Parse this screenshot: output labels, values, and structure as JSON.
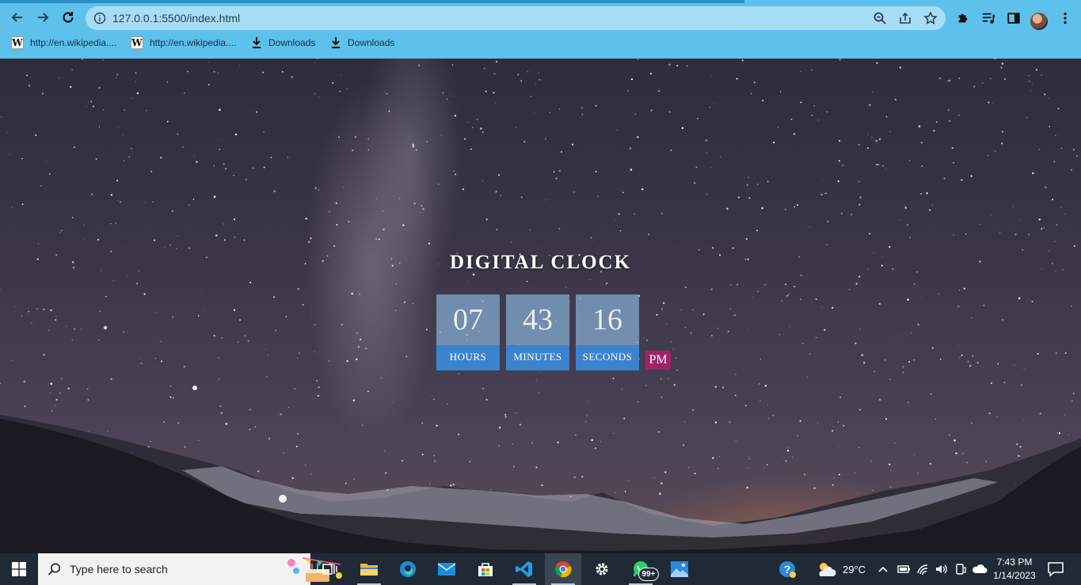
{
  "browser": {
    "url": "127.0.0.1:5500/index.html",
    "bookmarks": [
      {
        "label": "http://en.wikipedia....",
        "icon": "wikipedia-icon"
      },
      {
        "label": "http://en.wikipedia....",
        "icon": "wikipedia-icon"
      },
      {
        "label": "Downloads",
        "icon": "download-icon"
      },
      {
        "label": "Downloads",
        "icon": "download-icon"
      }
    ],
    "accent_color": "#5dc1ec"
  },
  "page": {
    "title": "DIGITAL CLOCK",
    "hours": {
      "value": "07",
      "label": "HOURS"
    },
    "minutes": {
      "value": "43",
      "label": "MINUTES"
    },
    "seconds": {
      "value": "16",
      "label": "SECONDS"
    },
    "ampm": "PM",
    "colors": {
      "digit_box": "#85add2",
      "label_box": "#3b83cf",
      "ampm_box": "#a0226a"
    }
  },
  "taskbar": {
    "search_placeholder": "Type here to search",
    "apps": [
      "task-view",
      "file-explorer",
      "edge",
      "mail",
      "store",
      "vscode",
      "chrome",
      "settings",
      "whatsapp",
      "photos"
    ],
    "whatsapp_badge": "99+",
    "weather_temp": "29°C",
    "time": "7:43 PM",
    "date": "1/14/2023"
  }
}
